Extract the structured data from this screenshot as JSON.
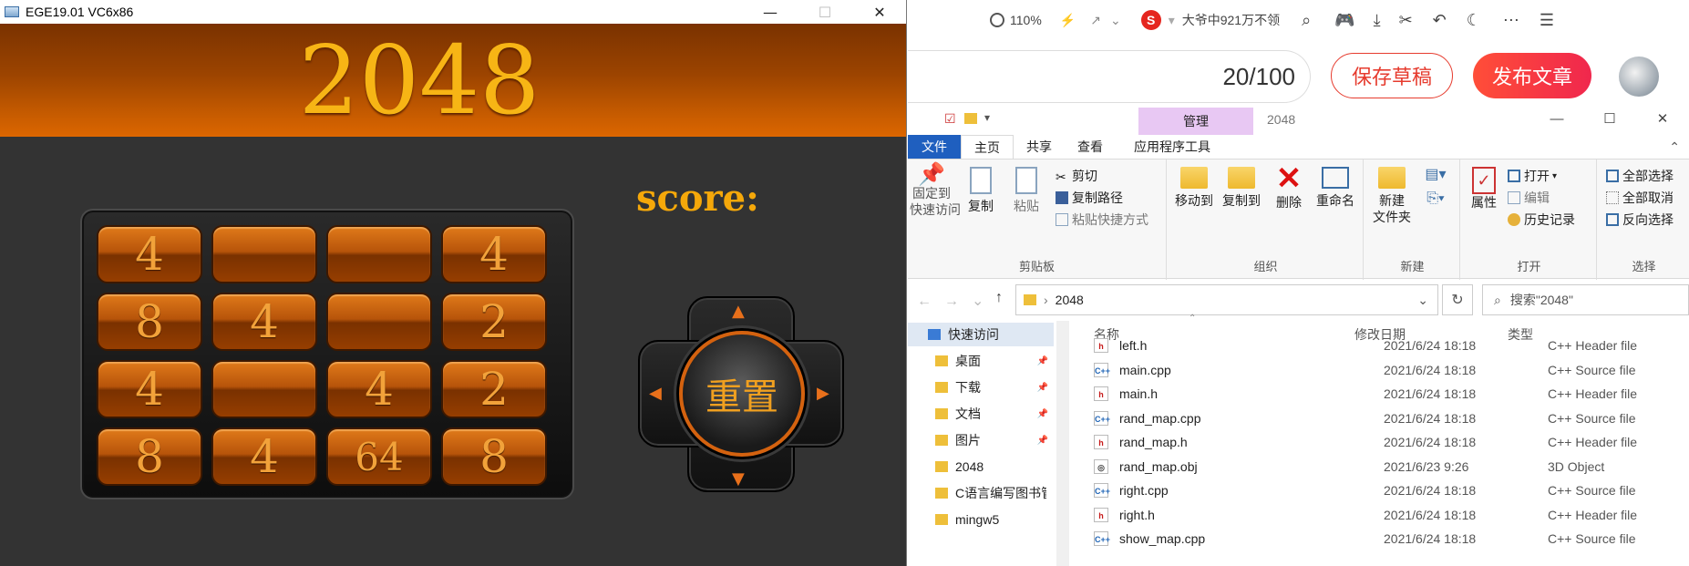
{
  "game": {
    "window_title": "EGE19.01 VC6x86",
    "window_buttons": {
      "minimize": "—",
      "maximize": "☐",
      "close": "✕"
    },
    "title": "2048",
    "score_label": "score:",
    "reset_label": "重置",
    "tiles": [
      "4",
      "",
      "",
      "4",
      "8",
      "4",
      "",
      "2",
      "4",
      "",
      "4",
      "2",
      "8",
      "4",
      "64",
      "8"
    ],
    "colors": {
      "banner": "#9c4400",
      "tile": "#b7540a",
      "text": "#f7b515"
    }
  },
  "browser": {
    "zoom": "110%",
    "search_suggestion": "大爷中921万不领",
    "word_count": "20/100",
    "save_draft": "保存草稿",
    "publish": "发布文章",
    "icons": [
      "zoom-icon",
      "lightning-icon",
      "share-icon",
      "sogou-icon",
      "search-icon",
      "game-icon",
      "download-icon",
      "scissors-icon",
      "undo-icon",
      "moon-icon",
      "more-icon",
      "menu-icon"
    ]
  },
  "explorer": {
    "context_tab": "管理",
    "folder_name": "2048",
    "window_buttons": {
      "minimize": "—",
      "maximize": "☐",
      "close": "✕"
    },
    "tabs": [
      "文件",
      "主页",
      "共享",
      "查看",
      "应用程序工具"
    ],
    "ribbon": {
      "clipboard": {
        "label": "剪贴板",
        "pin": "固定到\n快速访问",
        "copy": "复制",
        "paste": "粘贴",
        "cut": "剪切",
        "copy_path": "复制路径",
        "paste_shortcut": "粘贴快捷方式"
      },
      "organize": {
        "label": "组织",
        "move_to": "移动到",
        "copy_to": "复制到",
        "delete": "删除",
        "rename": "重命名"
      },
      "new": {
        "label": "新建",
        "new_folder": "新建\n文件夹"
      },
      "open": {
        "label": "打开",
        "properties": "属性",
        "open": "打开",
        "edit": "编辑",
        "history": "历史记录"
      },
      "select": {
        "label": "选择",
        "select_all": "全部选择",
        "select_none": "全部取消",
        "invert": "反向选择"
      }
    },
    "address": "2048",
    "search_placeholder": "搜索\"2048\"",
    "nav": [
      {
        "label": "快速访问",
        "pinned": false
      },
      {
        "label": "桌面",
        "pinned": true
      },
      {
        "label": "下载",
        "pinned": true
      },
      {
        "label": "文档",
        "pinned": true
      },
      {
        "label": "图片",
        "pinned": true
      },
      {
        "label": "2048",
        "pinned": false
      },
      {
        "label": "C语言编写图书管",
        "pinned": false
      },
      {
        "label": "mingw5",
        "pinned": false
      }
    ],
    "columns": {
      "name": "名称",
      "date": "修改日期",
      "type": "类型"
    },
    "files": [
      {
        "name": "left.h",
        "date": "2021/6/24 18:18",
        "type": "C++ Header file",
        "kind": "h"
      },
      {
        "name": "main.cpp",
        "date": "2021/6/24 18:18",
        "type": "C++ Source file",
        "kind": "cpp"
      },
      {
        "name": "main.h",
        "date": "2021/6/24 18:18",
        "type": "C++ Header file",
        "kind": "h"
      },
      {
        "name": "rand_map.cpp",
        "date": "2021/6/24 18:18",
        "type": "C++ Source file",
        "kind": "cpp"
      },
      {
        "name": "rand_map.h",
        "date": "2021/6/24 18:18",
        "type": "C++ Header file",
        "kind": "h"
      },
      {
        "name": "rand_map.obj",
        "date": "2021/6/23 9:26",
        "type": "3D Object",
        "kind": "obj"
      },
      {
        "name": "right.cpp",
        "date": "2021/6/24 18:18",
        "type": "C++ Source file",
        "kind": "cpp"
      },
      {
        "name": "right.h",
        "date": "2021/6/24 18:18",
        "type": "C++ Header file",
        "kind": "h"
      },
      {
        "name": "show_map.cpp",
        "date": "2021/6/24 18:18",
        "type": "C++ Source file",
        "kind": "cpp"
      }
    ]
  }
}
